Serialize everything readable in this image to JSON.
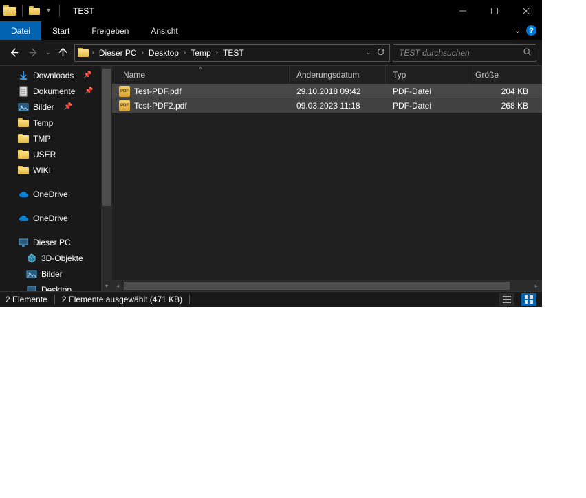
{
  "window_title": "TEST",
  "ribbon": {
    "file": "Datei",
    "tabs": [
      "Start",
      "Freigeben",
      "Ansicht"
    ]
  },
  "breadcrumb": [
    "Dieser PC",
    "Desktop",
    "Temp",
    "TEST"
  ],
  "search_placeholder": "TEST durchsuchen",
  "tree": [
    {
      "label": "Downloads",
      "icon": "download",
      "pinned": true
    },
    {
      "label": "Dokumente",
      "icon": "docs",
      "pinned": true
    },
    {
      "label": "Bilder",
      "icon": "pics",
      "pinned": true
    },
    {
      "label": "Temp",
      "icon": "folder"
    },
    {
      "label": "TMP",
      "icon": "folder"
    },
    {
      "label": "USER",
      "icon": "folder"
    },
    {
      "label": "WIKI",
      "icon": "folder"
    },
    {
      "label": "OneDrive",
      "icon": "cloud",
      "spaced": true
    },
    {
      "label": "OneDrive",
      "icon": "cloud",
      "spaced": true
    },
    {
      "label": "Dieser PC",
      "icon": "pc",
      "spaced": true
    },
    {
      "label": "3D-Objekte",
      "icon": "obj3d",
      "lvl": 2
    },
    {
      "label": "Bilder",
      "icon": "pics",
      "lvl": 2
    },
    {
      "label": "Desktop",
      "icon": "desktop",
      "lvl": 2
    }
  ],
  "columns": {
    "name": "Name",
    "date": "Änderungsdatum",
    "type": "Typ",
    "size": "Größe"
  },
  "files": [
    {
      "name": "Test-PDF.pdf",
      "date": "29.10.2018 09:42",
      "type": "PDF-Datei",
      "size": "204 KB",
      "selected": true
    },
    {
      "name": "Test-PDF2.pdf",
      "date": "09.03.2023 11:18",
      "type": "PDF-Datei",
      "size": "268 KB",
      "selected": true
    }
  ],
  "status": {
    "count": "2 Elemente",
    "selection": "2 Elemente ausgewählt (471 KB)"
  }
}
